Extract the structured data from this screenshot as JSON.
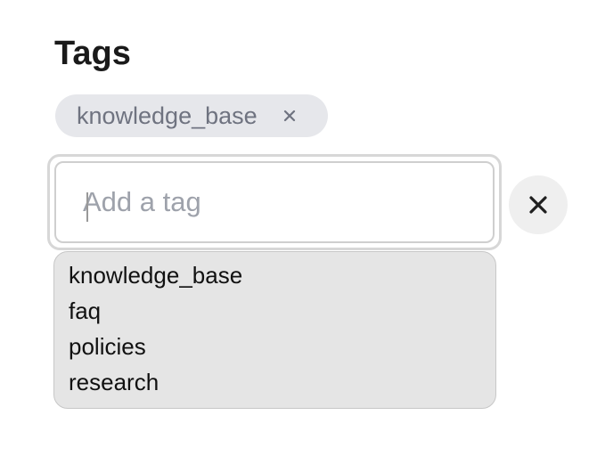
{
  "section": {
    "title": "Tags"
  },
  "selected_tags": [
    {
      "label": "knowledge_base",
      "remove_icon": "close-icon"
    }
  ],
  "tag_input": {
    "value": "",
    "placeholder": "Add a tag"
  },
  "clear_button": {
    "icon": "close-icon"
  },
  "suggestions": [
    {
      "label": "knowledge_base"
    },
    {
      "label": "faq"
    },
    {
      "label": "policies"
    },
    {
      "label": "research"
    }
  ],
  "colors": {
    "chip_background": "#e6e7eb",
    "chip_text": "#6f7380",
    "dropdown_background": "#e5e5e5",
    "clear_button_background": "#efefef"
  }
}
